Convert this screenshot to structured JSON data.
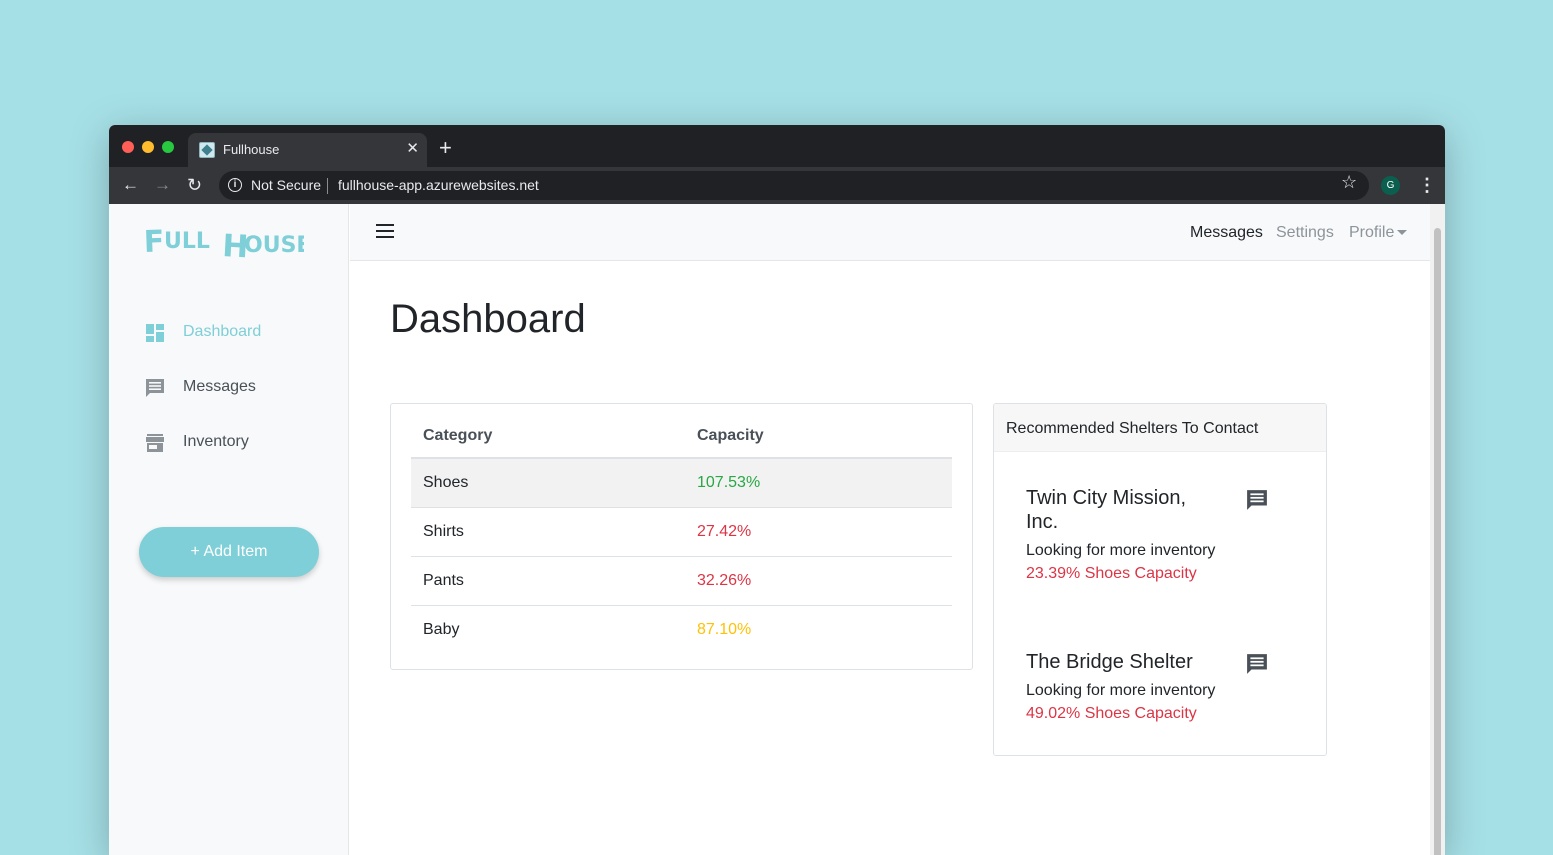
{
  "browser": {
    "tab_title": "Fullhouse",
    "tab_close": "✕",
    "new_tab": "+",
    "security_label": "Not Secure",
    "url": "fullhouse-app.azurewebsites.net",
    "profile_initial": "G"
  },
  "sidebar": {
    "logo_text": "Full House",
    "items": [
      {
        "label": "Dashboard",
        "icon": "dashboard-icon",
        "active": true
      },
      {
        "label": "Messages",
        "icon": "message-icon",
        "active": false
      },
      {
        "label": "Inventory",
        "icon": "store-icon",
        "active": false
      }
    ],
    "add_button": "+ Add Item"
  },
  "topnav": {
    "messages": "Messages",
    "settings": "Settings",
    "profile": "Profile"
  },
  "main": {
    "title": "Dashboard"
  },
  "capacity_table": {
    "headers": [
      "Category",
      "Capacity"
    ],
    "rows": [
      {
        "category": "Shoes",
        "capacity": "107.53%",
        "color": "#28a745"
      },
      {
        "category": "Shirts",
        "capacity": "27.42%",
        "color": "#dc3545"
      },
      {
        "category": "Pants",
        "capacity": "32.26%",
        "color": "#dc3545"
      },
      {
        "category": "Baby",
        "capacity": "87.10%",
        "color": "#ffc107"
      }
    ]
  },
  "recommended": {
    "title": "Recommended Shelters To Contact",
    "shelters": [
      {
        "name": "Twin City Mission, Inc.",
        "note": "Looking for more inventory",
        "capacity": "23.39% Shoes Capacity"
      },
      {
        "name": "The Bridge Shelter",
        "note": "Looking for more inventory",
        "capacity": "49.02% Shoes Capacity"
      }
    ]
  },
  "colors": {
    "accent": "#7ecfd8",
    "danger": "#dc3545",
    "success": "#28a745",
    "warning": "#ffc107",
    "background": "#a6e0e7"
  }
}
